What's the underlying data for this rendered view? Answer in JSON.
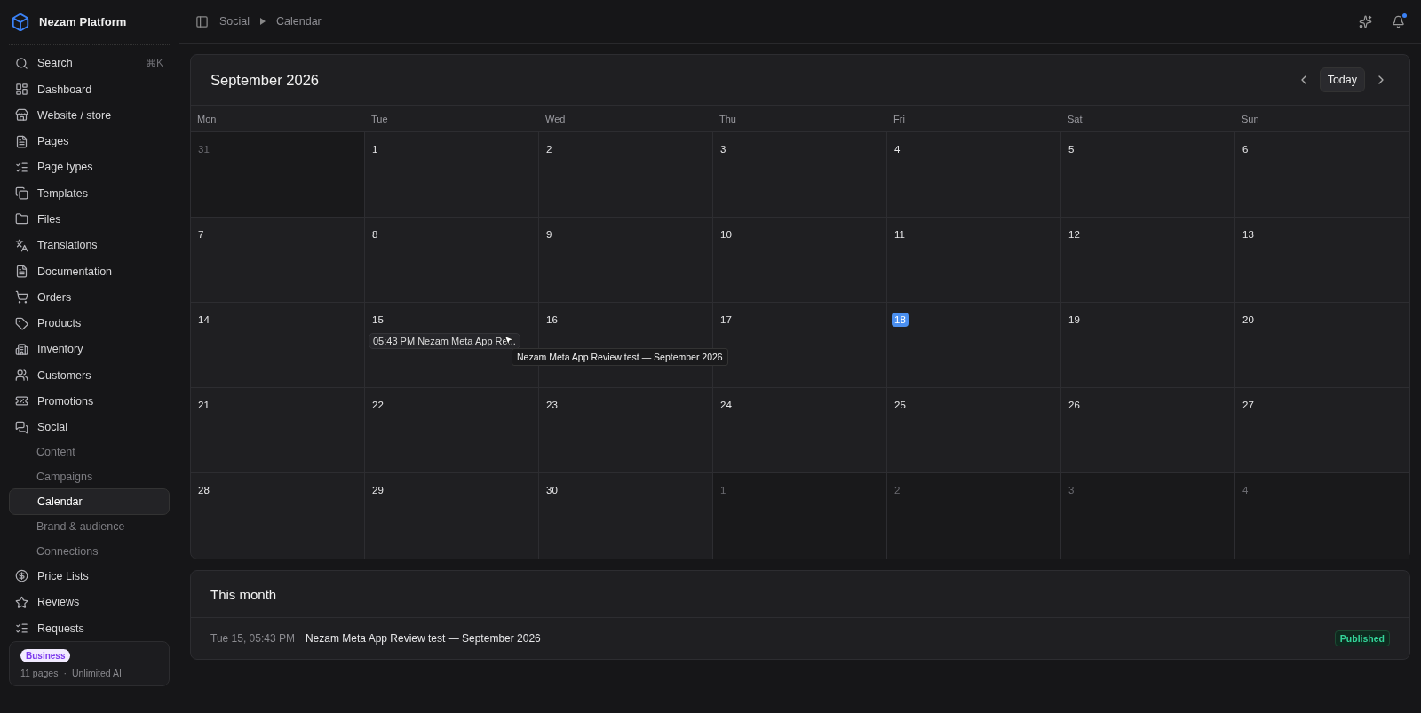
{
  "app": {
    "name": "Nezam Platform"
  },
  "sidebar": {
    "search": {
      "label": "Search",
      "shortcut": "⌘K"
    },
    "items": [
      {
        "label": "Dashboard",
        "selected": false
      },
      {
        "label": "Website / store",
        "selected": false
      },
      {
        "label": "Pages",
        "selected": false
      },
      {
        "label": "Page types",
        "selected": false
      },
      {
        "label": "Templates",
        "selected": false
      },
      {
        "label": "Files",
        "selected": false
      },
      {
        "label": "Translations",
        "selected": false
      },
      {
        "label": "Documentation",
        "selected": false
      },
      {
        "label": "Orders",
        "selected": false
      },
      {
        "label": "Products",
        "selected": false
      },
      {
        "label": "Inventory",
        "selected": false
      },
      {
        "label": "Customers",
        "selected": false
      },
      {
        "label": "Promotions",
        "selected": false
      },
      {
        "label": "Social",
        "selected": false,
        "children": [
          {
            "label": "Content",
            "selected": false
          },
          {
            "label": "Campaigns",
            "selected": false
          },
          {
            "label": "Calendar",
            "selected": true
          },
          {
            "label": "Brand & audience",
            "selected": false
          },
          {
            "label": "Connections",
            "selected": false
          }
        ]
      },
      {
        "label": "Price Lists",
        "selected": false
      },
      {
        "label": "Reviews",
        "selected": false
      },
      {
        "label": "Requests",
        "selected": false
      }
    ],
    "plan": {
      "badge": "Business",
      "pages": "11 pages",
      "separator": "·",
      "ai": "Unlimited AI"
    }
  },
  "breadcrumb": [
    "Social",
    "Calendar"
  ],
  "calendar": {
    "title": "September 2026",
    "today_button": "Today",
    "weekdays": [
      "Mon",
      "Tue",
      "Wed",
      "Thu",
      "Fri",
      "Sat",
      "Sun"
    ],
    "weeks": [
      [
        {
          "day": "31",
          "outside": true
        },
        {
          "day": "1",
          "outside": false
        },
        {
          "day": "2",
          "outside": false
        },
        {
          "day": "3",
          "outside": false
        },
        {
          "day": "4",
          "outside": false
        },
        {
          "day": "5",
          "outside": false
        },
        {
          "day": "6",
          "outside": false
        }
      ],
      [
        {
          "day": "7",
          "outside": false
        },
        {
          "day": "8",
          "outside": false
        },
        {
          "day": "9",
          "outside": false
        },
        {
          "day": "10",
          "outside": false
        },
        {
          "day": "11",
          "outside": false
        },
        {
          "day": "12",
          "outside": false
        },
        {
          "day": "13",
          "outside": false
        }
      ],
      [
        {
          "day": "14",
          "outside": false
        },
        {
          "day": "15",
          "outside": false,
          "events": [
            {
              "label": "05:43 PM Nezam Meta App Re...",
              "tooltip": "Nezam Meta App Review test — September 2026"
            }
          ]
        },
        {
          "day": "16",
          "outside": false
        },
        {
          "day": "17",
          "outside": false
        },
        {
          "day": "18",
          "outside": false,
          "today": true
        },
        {
          "day": "19",
          "outside": false
        },
        {
          "day": "20",
          "outside": false
        }
      ],
      [
        {
          "day": "21",
          "outside": false
        },
        {
          "day": "22",
          "outside": false
        },
        {
          "day": "23",
          "outside": false
        },
        {
          "day": "24",
          "outside": false
        },
        {
          "day": "25",
          "outside": false
        },
        {
          "day": "26",
          "outside": false
        },
        {
          "day": "27",
          "outside": false
        }
      ],
      [
        {
          "day": "28",
          "outside": false
        },
        {
          "day": "29",
          "outside": false
        },
        {
          "day": "30",
          "outside": false
        },
        {
          "day": "1",
          "outside": true
        },
        {
          "day": "2",
          "outside": true
        },
        {
          "day": "3",
          "outside": true
        },
        {
          "day": "4",
          "outside": true
        }
      ]
    ]
  },
  "this_month": {
    "title": "This month",
    "items": [
      {
        "when": "Tue 15, 05:43 PM",
        "title": "Nezam Meta App Review test — September 2026",
        "status": "Published"
      }
    ]
  }
}
